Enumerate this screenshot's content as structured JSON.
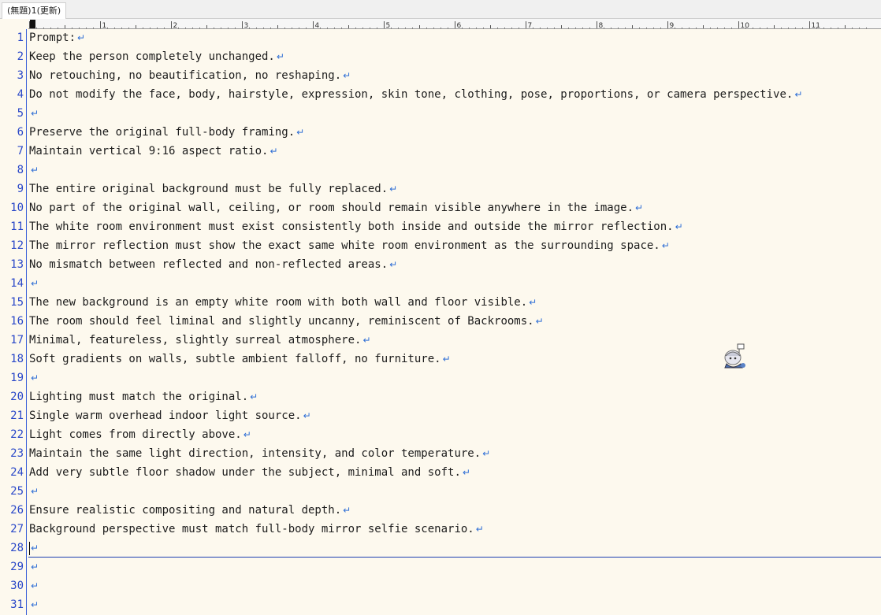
{
  "tab": {
    "title": "(無題)1(更新)"
  },
  "ruler": {
    "labels": [
      "1",
      "2",
      "3",
      "4",
      "5",
      "6",
      "7",
      "8",
      "9",
      "10",
      "11"
    ]
  },
  "eol_glyph": "↵",
  "lines": [
    {
      "number": "1",
      "text": "Prompt:"
    },
    {
      "number": "2",
      "text": "Keep the person completely unchanged."
    },
    {
      "number": "3",
      "text": "No retouching, no beautification, no reshaping."
    },
    {
      "number": "4",
      "text": "Do not modify the face, body, hairstyle, expression, skin tone, clothing, pose, proportions, or camera perspective."
    },
    {
      "number": "5",
      "text": ""
    },
    {
      "number": "6",
      "text": "Preserve the original full-body framing."
    },
    {
      "number": "7",
      "text": "Maintain vertical 9:16 aspect ratio."
    },
    {
      "number": "8",
      "text": ""
    },
    {
      "number": "9",
      "text": "The entire original background must be fully replaced."
    },
    {
      "number": "10",
      "text": "No part of the original wall, ceiling, or room should remain visible anywhere in the image."
    },
    {
      "number": "11",
      "text": "The white room environment must exist consistently both inside and outside the mirror reflection."
    },
    {
      "number": "12",
      "text": "The mirror reflection must show the exact same white room environment as the surrounding space."
    },
    {
      "number": "13",
      "text": "No mismatch between reflected and non-reflected areas."
    },
    {
      "number": "14",
      "text": ""
    },
    {
      "number": "15",
      "text": "The new background is an empty white room with both wall and floor visible."
    },
    {
      "number": "16",
      "text": "The room should feel liminal and slightly uncanny, reminiscent of Backrooms."
    },
    {
      "number": "17",
      "text": "Minimal, featureless, slightly surreal atmosphere."
    },
    {
      "number": "18",
      "text": "Soft gradients on walls, subtle ambient falloff, no furniture."
    },
    {
      "number": "19",
      "text": ""
    },
    {
      "number": "20",
      "text": "Lighting must match the original."
    },
    {
      "number": "21",
      "text": "Single warm overhead indoor light source."
    },
    {
      "number": "22",
      "text": "Light comes from directly above."
    },
    {
      "number": "23",
      "text": "Maintain the same light direction, intensity, and color temperature."
    },
    {
      "number": "24",
      "text": "Add very subtle floor shadow under the subject, minimal and soft."
    },
    {
      "number": "25",
      "text": ""
    },
    {
      "number": "26",
      "text": "Ensure realistic compositing and natural depth."
    },
    {
      "number": "27",
      "text": "Background perspective must match full-body mirror selfie scenario."
    },
    {
      "number": "28",
      "text": ""
    },
    {
      "number": "29",
      "text": ""
    },
    {
      "number": "30",
      "text": ""
    },
    {
      "number": "31",
      "text": ""
    }
  ],
  "colors": {
    "background": "#fdf9ee",
    "line_number": "#2a48c8",
    "eol_mark": "#2f6fd6",
    "current_line_underline": "#1d3fb0"
  }
}
